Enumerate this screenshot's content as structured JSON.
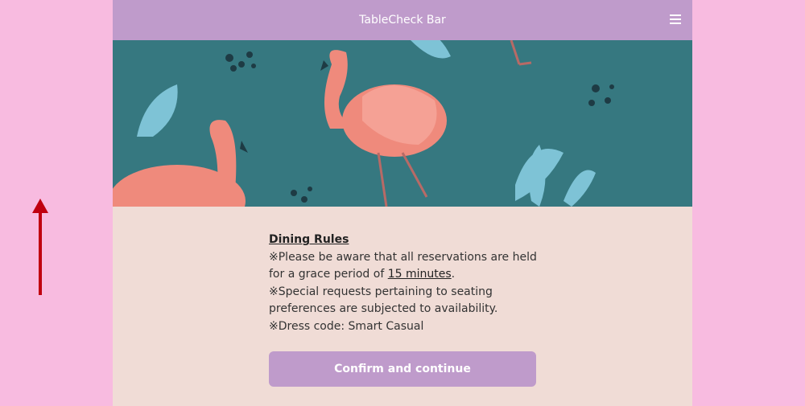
{
  "header": {
    "title": "TableCheck Bar",
    "menu_icon": "hamburger-menu-icon"
  },
  "hero": {
    "image": "flamingo-pattern-illustration"
  },
  "rules": {
    "title": "Dining Rules",
    "grace_text_before": "※Please be aware that all reservations are held for a grace period of ",
    "grace_link": "15 minutes",
    "grace_text_after": ".",
    "special_requests": "※Special requests pertaining to seating preferences are subjected to availability.",
    "dress_code": "※Dress code: Smart Casual"
  },
  "actions": {
    "confirm_label": "Confirm and continue"
  },
  "colors": {
    "page_background": "#f8bbe0",
    "header": "#bf9bcb",
    "content_background": "#f0dcd6",
    "hero_background": "#367880",
    "arrow": "#c00010"
  }
}
